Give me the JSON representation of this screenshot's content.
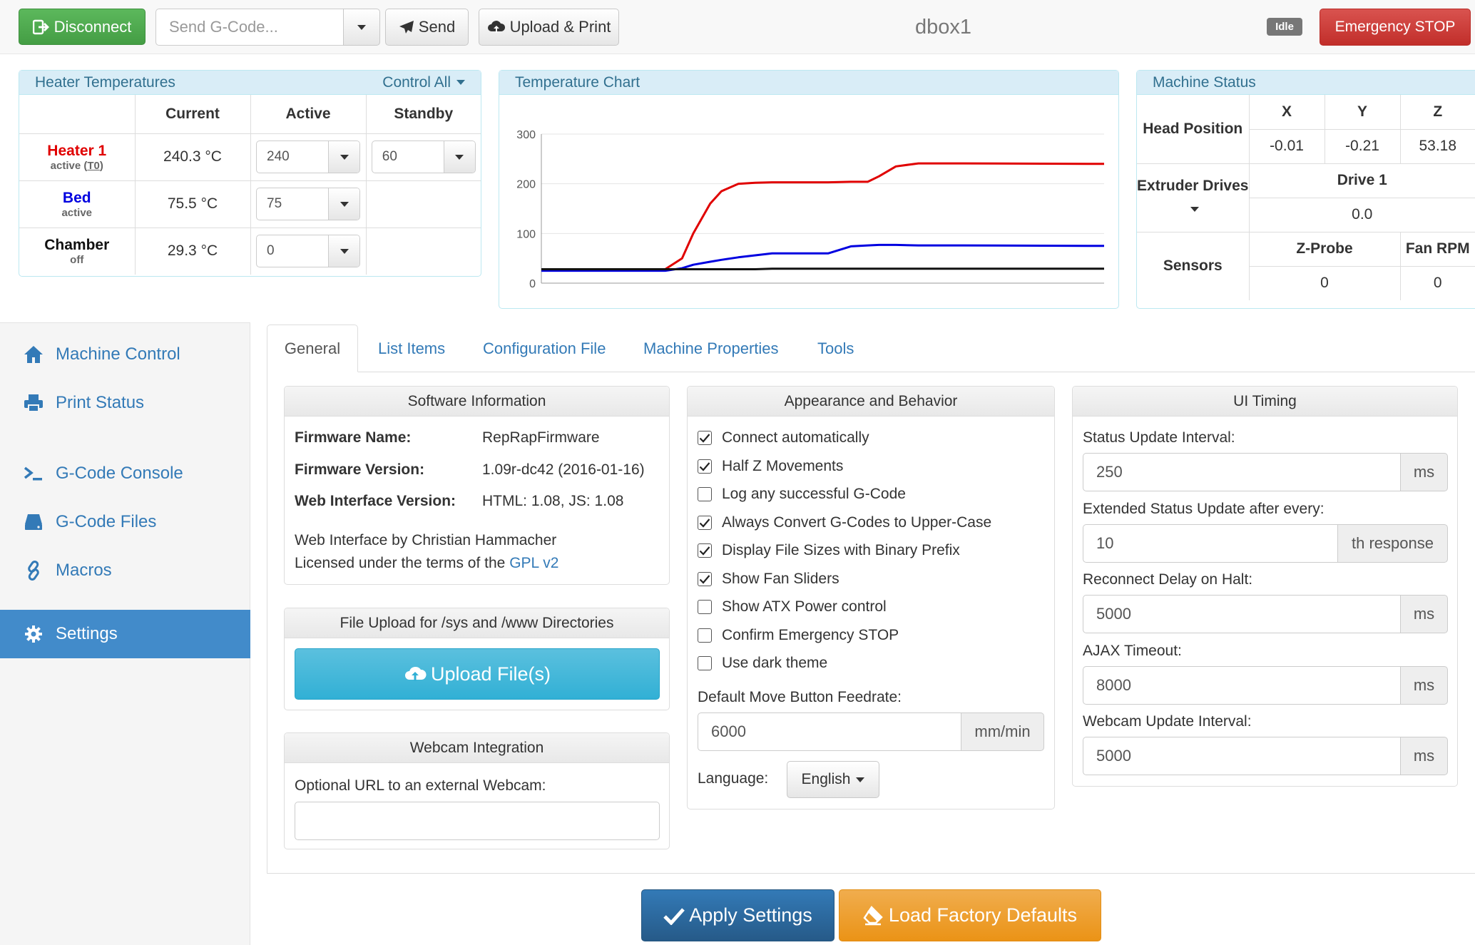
{
  "topbar": {
    "disconnect_label": "Disconnect",
    "gcode_placeholder": "Send G-Code...",
    "send_label": "Send",
    "upload_print_label": "Upload & Print",
    "machine_name": "dbox1",
    "status_badge": "Idle",
    "emergency_label": "Emergency STOP"
  },
  "heaters": {
    "title": "Heater Temperatures",
    "control_all": "Control All",
    "headers": [
      "Current",
      "Active",
      "Standby"
    ],
    "rows": [
      {
        "name": "Heater 1",
        "state_prefix": "active (",
        "tool": "T0",
        "state_suffix": ")",
        "current": "240.3 °C",
        "active": "240",
        "standby": "60",
        "color": "#e00000"
      },
      {
        "name": "Bed",
        "state": "active",
        "current": "75.5 °C",
        "active": "75",
        "color": "#0000e0"
      },
      {
        "name": "Chamber",
        "state": "off",
        "current": "29.3 °C",
        "active": "0",
        "color": "#111111"
      }
    ]
  },
  "chart": {
    "title": "Temperature Chart"
  },
  "chart_data": {
    "type": "line",
    "title": "Temperature Chart",
    "ylim": [
      0,
      300
    ],
    "yticks": [
      0,
      100,
      200,
      300
    ],
    "x": [
      0,
      8,
      16,
      22,
      25,
      27,
      30,
      32,
      35,
      38,
      41,
      42,
      43,
      50,
      51,
      55,
      58,
      60,
      63,
      67,
      75,
      100
    ],
    "series": [
      {
        "color": "#e00000",
        "values": [
          28,
          28,
          28,
          28,
          50,
          100,
          160,
          185,
          200,
          202,
          203,
          203,
          203,
          203,
          203,
          204,
          204,
          215,
          235,
          241,
          241,
          240
        ]
      },
      {
        "color": "#0000e0",
        "values": [
          25,
          25,
          25,
          25,
          30,
          37,
          43,
          47,
          52,
          56,
          60,
          60,
          60,
          60,
          60,
          74,
          76,
          77,
          77,
          76,
          76,
          75
        ]
      },
      {
        "color": "#111111",
        "values": [
          28,
          28,
          28,
          28,
          28,
          28,
          28,
          28,
          28,
          28,
          29,
          29,
          29,
          29,
          29,
          29,
          29,
          29,
          29,
          29,
          29,
          29
        ]
      }
    ]
  },
  "machine_status": {
    "title": "Machine Status",
    "head_position_label": "Head Position",
    "axes": [
      "X",
      "Y",
      "Z"
    ],
    "positions": [
      "-0.01",
      "-0.21",
      "53.18"
    ],
    "extruder_label": "Extruder Drives",
    "drive_label": "Drive 1",
    "drive_value": "0.0",
    "sensors_label": "Sensors",
    "zprobe_label": "Z-Probe",
    "fanrpm_label": "Fan RPM",
    "zprobe_value": "0",
    "fanrpm_value": "0"
  },
  "sidebar": {
    "items": [
      {
        "label": "Machine Control",
        "icon": "home-icon"
      },
      {
        "label": "Print Status",
        "icon": "printer-icon"
      },
      {
        "label": "G-Code Console",
        "icon": "console-icon"
      },
      {
        "label": "G-Code Files",
        "icon": "hdd-icon"
      },
      {
        "label": "Macros",
        "icon": "link-icon"
      },
      {
        "label": "Settings",
        "icon": "cog-icon"
      }
    ]
  },
  "tabs": [
    "General",
    "List Items",
    "Configuration File",
    "Machine Properties",
    "Tools"
  ],
  "software": {
    "title": "Software Information",
    "firmware_name_label": "Firmware Name:",
    "firmware_name": "RepRapFirmware",
    "firmware_version_label": "Firmware Version:",
    "firmware_version": "1.09r-dc42 (2016-01-16)",
    "web_version_label": "Web Interface Version:",
    "web_version": "HTML: 1.08, JS: 1.08",
    "credit_line": "Web Interface by Christian Hammacher",
    "license_prefix": "Licensed under the terms of the",
    "license_link": "GPL v2"
  },
  "file_upload": {
    "title": "File Upload for /sys and /www Directories",
    "button": "Upload File(s)"
  },
  "webcam": {
    "title": "Webcam Integration",
    "url_label": "Optional URL to an external Webcam:",
    "url_value": ""
  },
  "appearance": {
    "title": "Appearance and Behavior",
    "checkboxes": [
      {
        "label": "Connect automatically",
        "checked": true
      },
      {
        "label": "Half Z Movements",
        "checked": true
      },
      {
        "label": "Log any successful G-Code",
        "checked": false
      },
      {
        "label": "Always Convert G-Codes to Upper-Case",
        "checked": true
      },
      {
        "label": "Display File Sizes with Binary Prefix",
        "checked": true
      },
      {
        "label": "Show Fan Sliders",
        "checked": true
      },
      {
        "label": "Show ATX Power control",
        "checked": false
      },
      {
        "label": "Confirm Emergency STOP",
        "checked": false
      },
      {
        "label": "Use dark theme",
        "checked": false
      }
    ],
    "feedrate_label": "Default Move Button Feedrate:",
    "feedrate_value": "6000",
    "feedrate_unit": "mm/min",
    "language_label": "Language:",
    "language_value": "English"
  },
  "timing": {
    "title": "UI Timing",
    "fields": [
      {
        "label": "Status Update Interval:",
        "value": "250",
        "unit": "ms"
      },
      {
        "label": "Extended Status Update after every:",
        "value": "10",
        "unit": "th response"
      },
      {
        "label": "Reconnect Delay on Halt:",
        "value": "5000",
        "unit": "ms"
      },
      {
        "label": "AJAX Timeout:",
        "value": "8000",
        "unit": "ms"
      },
      {
        "label": "Webcam Update Interval:",
        "value": "5000",
        "unit": "ms"
      }
    ]
  },
  "footer": {
    "apply_label": "Apply Settings",
    "defaults_label": "Load Factory Defaults"
  }
}
